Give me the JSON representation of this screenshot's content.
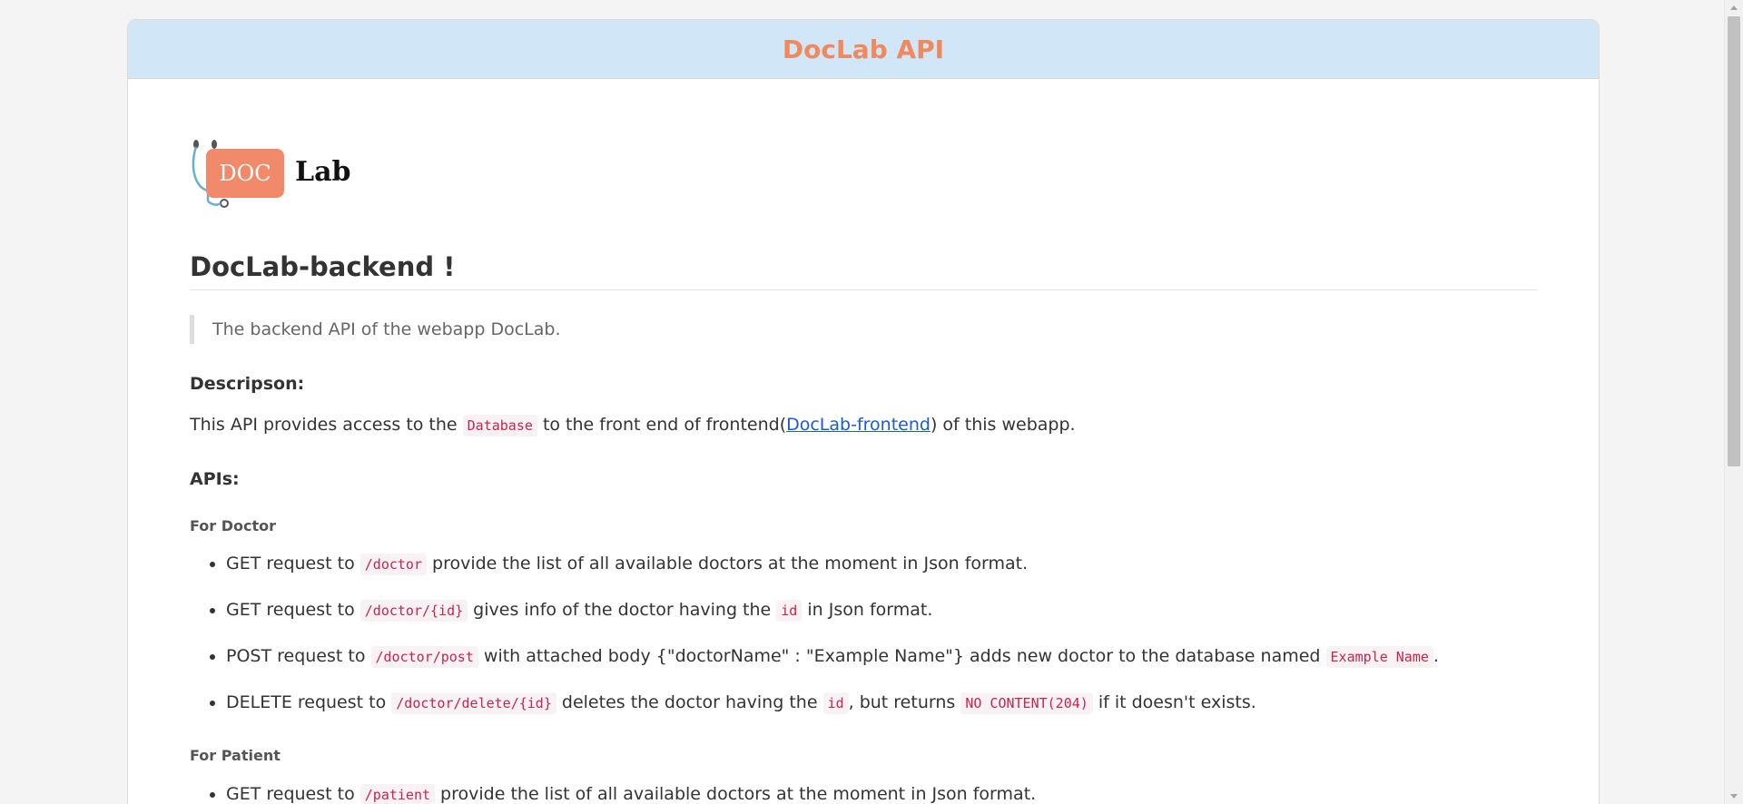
{
  "header": {
    "title": "DocLab API"
  },
  "logo": {
    "doc_text": "DOC",
    "lab_text": "Lab"
  },
  "main": {
    "heading": "DocLab-backend !",
    "quote": "The backend API of the webapp DocLab.",
    "description_heading": "Descripson:",
    "description": {
      "before_code": "This API provides access to the ",
      "code": "Database",
      "middle": " to the front end of frontend(",
      "link_text": "DocLab-frontend",
      "after": ") of this webapp."
    },
    "apis_heading": "APIs:",
    "doctor_section": {
      "heading": "For Doctor",
      "items": [
        {
          "a": "GET request to ",
          "code1": "/doctor",
          "b": " provide the list of all available doctors at the moment in Json format."
        },
        {
          "a": "GET request to ",
          "code1": "/doctor/{id}",
          "b": " gives info of the doctor having the ",
          "code2": "id",
          "c": " in Json format."
        },
        {
          "a": "POST request to ",
          "code1": "/doctor/post",
          "b": " with attached body {\"doctorName\" : \"Example Name\"} adds new doctor to the database named ",
          "code2": "Example Name",
          "c": "."
        },
        {
          "a": "DELETE request to ",
          "code1": "/doctor/delete/{id}",
          "b": " deletes the doctor having the ",
          "code2": "id",
          "c": ", but returns ",
          "code3": "NO CONTENT(204)",
          "d": " if it doesn't exists."
        }
      ]
    },
    "patient_section": {
      "heading": "For Patient",
      "items": [
        {
          "a": "GET request to ",
          "code1": "/patient",
          "b": " provide the list of all available doctors at the moment in Json format."
        }
      ]
    }
  }
}
